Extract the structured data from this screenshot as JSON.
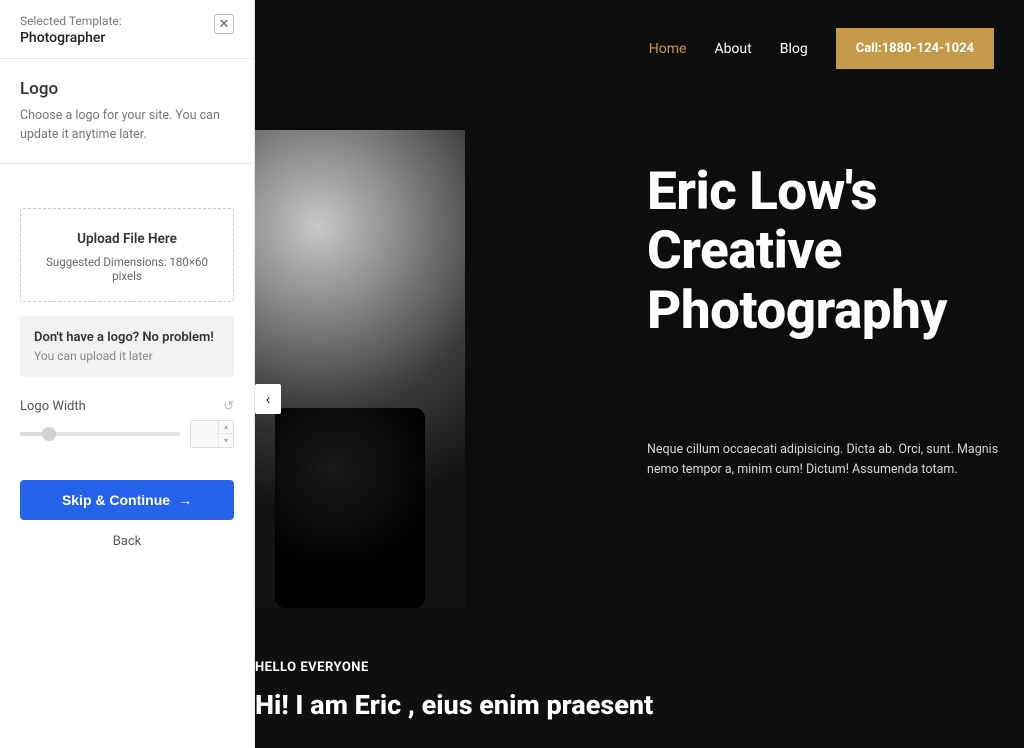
{
  "sidebar": {
    "template_label": "Selected Template:",
    "template_name": "Photographer",
    "section_heading": "Logo",
    "section_desc": "Choose a logo for your site. You can update it anytime later.",
    "upload": {
      "title": "Upload File Here",
      "sub": "Suggested Dimensions: 180×60 pixels"
    },
    "nologo": {
      "title": "Don't have a logo? No problem!",
      "sub": "You can upload it later"
    },
    "width_label": "Logo Width",
    "primary_btn": "Skip & Continue",
    "back": "Back"
  },
  "preview": {
    "nav": {
      "home": "Home",
      "about": "About",
      "blog": "Blog"
    },
    "call_btn": "Call:1880-124-1024",
    "hero_title": "Eric Low's Creative Photography",
    "hero_para": "Neque cillum occaecati adipisicing. Dicta ab. Orci, sunt. Magnis nemo tempor a, minim cum! Dictum! Assumenda totam.",
    "eyebrow": "HELLO EVERYONE",
    "sec2_title": "Hi! I am Eric , eius enim praesent"
  }
}
